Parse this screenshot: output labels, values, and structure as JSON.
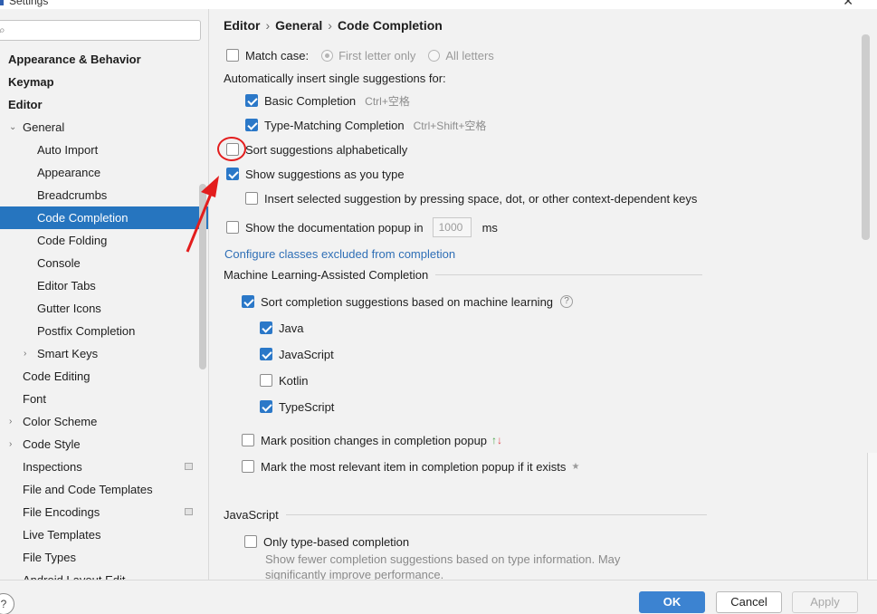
{
  "window": {
    "title": "Settings"
  },
  "search": {
    "placeholder": "",
    "value": ""
  },
  "sidebar": {
    "items": [
      {
        "label": "Appearance & Behavior"
      },
      {
        "label": "Keymap"
      },
      {
        "label": "Editor"
      },
      {
        "label": "General"
      },
      {
        "label": "Auto Import"
      },
      {
        "label": "Appearance"
      },
      {
        "label": "Breadcrumbs"
      },
      {
        "label": "Code Completion"
      },
      {
        "label": "Code Folding"
      },
      {
        "label": "Console"
      },
      {
        "label": "Editor Tabs"
      },
      {
        "label": "Gutter Icons"
      },
      {
        "label": "Postfix Completion"
      },
      {
        "label": "Smart Keys"
      },
      {
        "label": "Code Editing"
      },
      {
        "label": "Font"
      },
      {
        "label": "Color Scheme"
      },
      {
        "label": "Code Style"
      },
      {
        "label": "Inspections"
      },
      {
        "label": "File and Code Templates"
      },
      {
        "label": "File Encodings"
      },
      {
        "label": "Live Templates"
      },
      {
        "label": "File Types"
      },
      {
        "label": "Android Layout Edit"
      }
    ]
  },
  "breadcrumb": {
    "part1": "Editor",
    "part2": "General",
    "part3": "Code Completion",
    "sep": "›"
  },
  "match_case": {
    "label": "Match case:",
    "checked": false,
    "opt1": "First letter only",
    "opt2": "All letters"
  },
  "auto_insert": {
    "heading": "Automatically insert single suggestions for:",
    "basic": {
      "label": "Basic Completion",
      "shortcut": "Ctrl+空格",
      "checked": true
    },
    "type_matching": {
      "label": "Type-Matching Completion",
      "shortcut": "Ctrl+Shift+空格",
      "checked": true
    }
  },
  "sort_alpha": {
    "label": "Sort suggestions alphabetically",
    "checked": false
  },
  "show_as_type": {
    "label": "Show suggestions as you type",
    "checked": true
  },
  "insert_by_space": {
    "label": "Insert selected suggestion by pressing space, dot, or other context-dependent keys",
    "checked": false
  },
  "doc_popup": {
    "label": "Show the documentation popup in",
    "value": "1000",
    "unit": "ms",
    "checked": false
  },
  "configure_link": "Configure classes excluded from completion",
  "ml": {
    "heading": "Machine Learning-Assisted Completion",
    "sort_ml": {
      "label": "Sort completion suggestions based on machine learning",
      "checked": true
    },
    "languages": [
      {
        "label": "Java",
        "checked": true
      },
      {
        "label": "JavaScript",
        "checked": true
      },
      {
        "label": "Kotlin",
        "checked": false
      },
      {
        "label": "TypeScript",
        "checked": true
      }
    ],
    "mark_position": {
      "label": "Mark position changes in completion popup",
      "checked": false,
      "arrows": {
        "up": "↑",
        "down": "↓"
      }
    },
    "mark_relevant": {
      "label": "Mark the most relevant item in completion popup if it exists",
      "checked": false,
      "star": "★"
    }
  },
  "javascript": {
    "heading": "JavaScript",
    "only_type": {
      "label": "Only type-based completion",
      "checked": false
    },
    "desc": "Show fewer completion suggestions based on type information. May significantly improve performance."
  },
  "footer": {
    "help": "?",
    "ok": "OK",
    "cancel": "Cancel",
    "apply": "Apply"
  },
  "colors": {
    "accent": "#2675bf",
    "annotation": "#e31d1d",
    "link": "#2f6fb6"
  }
}
